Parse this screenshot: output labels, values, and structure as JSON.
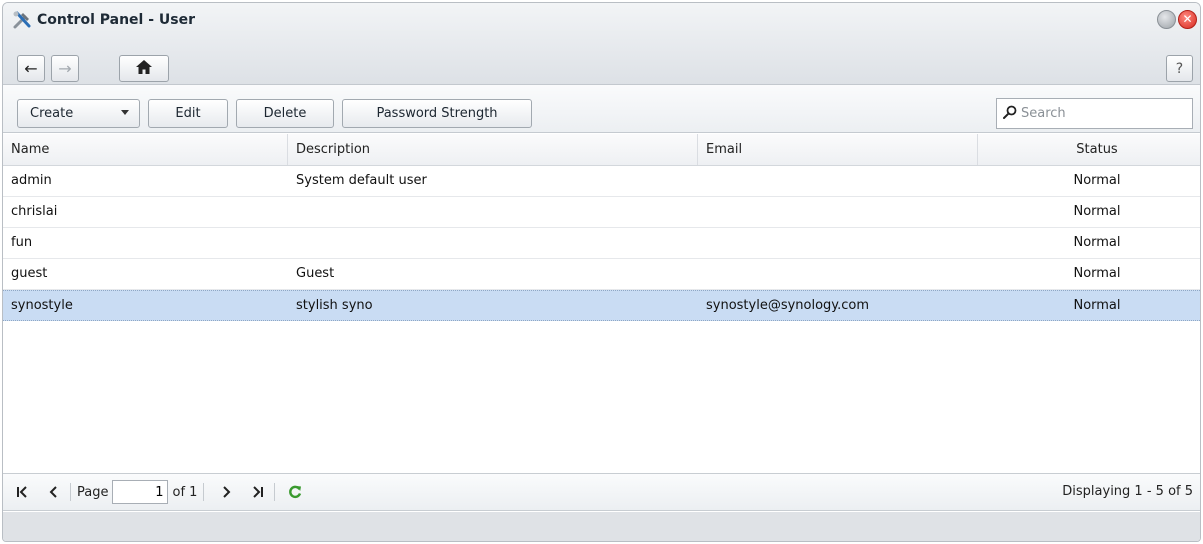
{
  "window": {
    "title": "Control Panel - User",
    "close_glyph": "✕"
  },
  "nav": {
    "back_icon": "←",
    "forward_icon": "→",
    "home_icon": "home-icon",
    "help_label": "?"
  },
  "toolbar": {
    "create_label": "Create",
    "edit_label": "Edit",
    "delete_label": "Delete",
    "password_strength_label": "Password Strength",
    "search_placeholder": "Search"
  },
  "grid": {
    "columns": {
      "name": "Name",
      "description": "Description",
      "email": "Email",
      "status": "Status"
    },
    "rows": [
      {
        "name": "admin",
        "description": "System default user",
        "email": "",
        "status": "Normal",
        "selected": false
      },
      {
        "name": "chrislai",
        "description": "",
        "email": "",
        "status": "Normal",
        "selected": false
      },
      {
        "name": "fun",
        "description": "",
        "email": "",
        "status": "Normal",
        "selected": false
      },
      {
        "name": "guest",
        "description": "Guest",
        "email": "",
        "status": "Normal",
        "selected": false
      },
      {
        "name": "synostyle",
        "description": "stylish syno",
        "email": "synostyle@synology.com",
        "status": "Normal",
        "selected": true
      }
    ]
  },
  "pager": {
    "page_label": "Page",
    "page_value": "1",
    "of_label": "of 1",
    "displaying": "Displaying 1 - 5 of 5"
  },
  "colors": {
    "selected_row": "#c9dcf3",
    "refresh": "#3a9a2f",
    "close_button": "#d6281f"
  }
}
